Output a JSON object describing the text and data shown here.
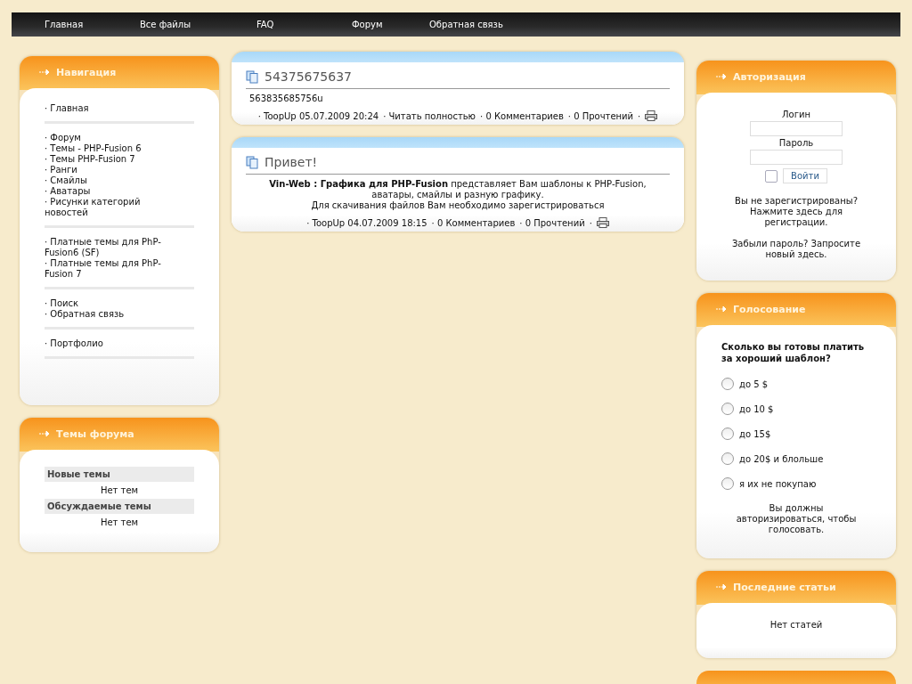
{
  "top_menu": [
    {
      "label": "Главная"
    },
    {
      "label": "Все файлы"
    },
    {
      "label": "FAQ"
    },
    {
      "label": "Форум"
    },
    {
      "label": "Обратная связь"
    }
  ],
  "left": {
    "navigation": {
      "title": "Навигация",
      "groups": [
        [
          "· Главная"
        ],
        [
          "· Форум",
          "· Темы - PHP-Fusion 6",
          "· Темы PHP-Fusion 7",
          "· Ранги",
          "· Смайлы",
          "· Аватары",
          "· Рисунки категорий новостей"
        ],
        [
          "· Платные темы для PhP-Fusion6 (SF)",
          "· Платные темы для PhP-Fusion 7"
        ],
        [
          "· Поиск",
          "· Обратная связь"
        ],
        [
          "· Портфолио"
        ]
      ]
    },
    "forum_threads": {
      "title": "Темы форума",
      "sections": [
        {
          "heading": "Новые темы",
          "text": "Нет тем"
        },
        {
          "heading": "Обсуждаемые темы",
          "text": "Нет тем"
        }
      ]
    }
  },
  "news": [
    {
      "title": "54375675637",
      "body": "563835685756u",
      "meta": [
        "· ToopUp 05.07.2009 20:24",
        "· Читать полностью",
        "· 0 Комментариев",
        "· 0 Прочтений",
        "·"
      ]
    },
    {
      "title": "Привет!",
      "body": "**Vin-Web : Графика для PHP-Fusion** представляет Вам шаблоны к PHP-Fusion, аватары, смайлы и разную графику.",
      "body2": "Для скачивания файлов Вам необходимо зарегистрироваться",
      "meta": [
        "· ToopUp 04.07.2009 18:15",
        "· 0 Комментариев",
        "· 0 Прочтений",
        "·"
      ]
    }
  ],
  "right": {
    "login": {
      "title": "Авторизация",
      "login_label": "Логин",
      "password_label": "Пароль",
      "remember": {
        "checked": false
      },
      "submit": "Войти",
      "register_text": "Вы не зарегистрированы? Нажмите здесь для регистрации.",
      "forgot_text": "Забыли пароль? Запросите новый здесь."
    },
    "poll": {
      "title": "Голосование",
      "question": "Сколько вы готовы платить за хороший шаблон?",
      "options": [
        {
          "label": "до 5 $",
          "selected": false
        },
        {
          "label": "до 10 $",
          "selected": false
        },
        {
          "label": "до 15$",
          "selected": false
        },
        {
          "label": "до 20$ и блольше",
          "selected": false
        },
        {
          "label": "я их не покупаю",
          "selected": false
        }
      ],
      "note": "Вы должны авторизироваться, чтобы голосовать."
    },
    "articles": {
      "title": "Последние статьи",
      "text": "Нет статей"
    }
  }
}
